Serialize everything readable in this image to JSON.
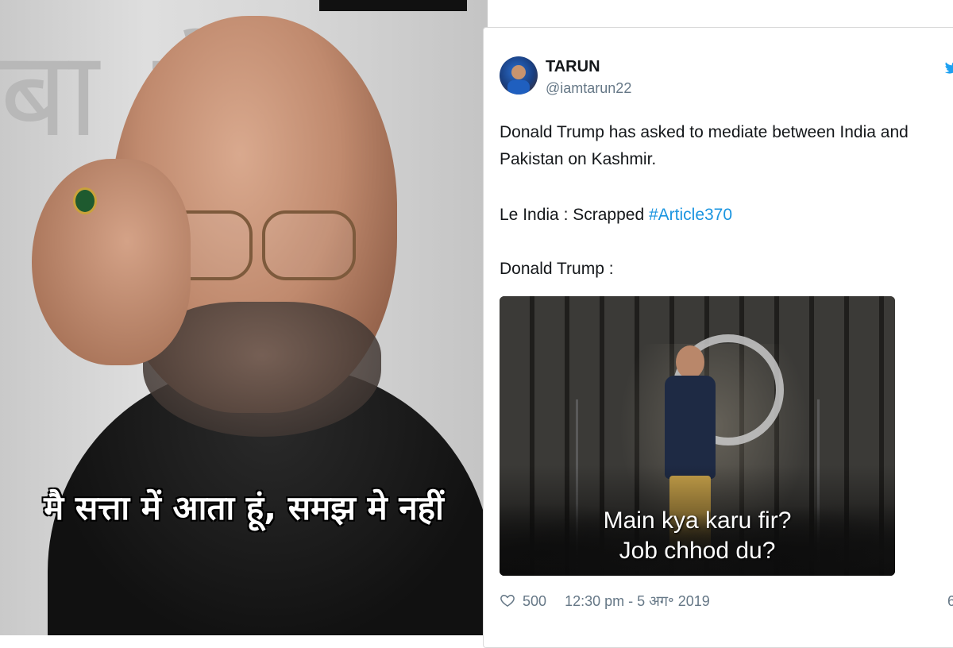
{
  "meme": {
    "caption": "मै सत्ता में आता हूं, समझ मे नहीं",
    "background_text": "बा से"
  },
  "tweet": {
    "user": {
      "name": "TARUN",
      "handle": "@iamtarun22"
    },
    "lines": [
      "Donald Trump has asked to mediate between India and",
      "Pakistan on Kashmir."
    ],
    "line3_prefix": "Le India : Scrapped ",
    "hashtag": "#Article370",
    "line4": "Donald Trump :",
    "media": {
      "caption_line_1": "Main kya karu fir?",
      "caption_line_2": "Job chhod du?"
    },
    "footer": {
      "like_count": "500",
      "timestamp": "12:30 pm - 5 अग॰ 2019"
    },
    "icons": {
      "brand": "twitter-bird-icon",
      "like": "heart-icon",
      "info": "info-icon"
    },
    "colors": {
      "link": "#1b95e0",
      "twitter_blue": "#1da1f2",
      "meta_gray": "#657786"
    }
  }
}
